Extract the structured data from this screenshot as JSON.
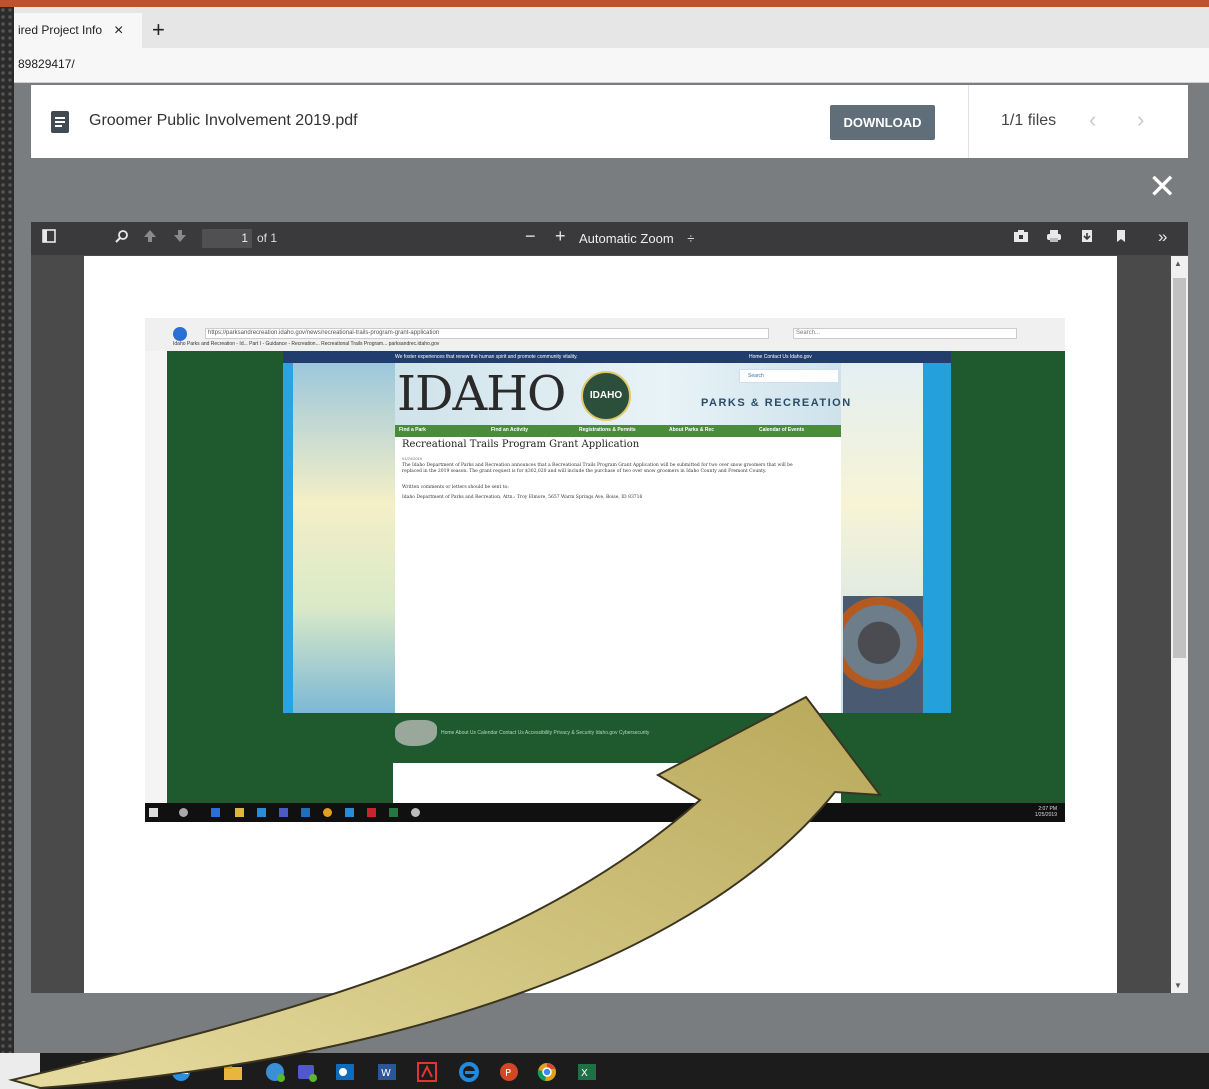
{
  "browser": {
    "tab_title": "ired Project Info",
    "tab_close": "×",
    "new_tab": "+",
    "address": "89829417/"
  },
  "file_bar": {
    "file_name": "Groomer Public Involvement 2019.pdf",
    "download_label": "DOWNLOAD",
    "files_count": "1/1 files",
    "prev": "‹",
    "next": "›"
  },
  "overlay_close": "✕",
  "pdf_toolbar": {
    "page_number": "1",
    "page_of": "of 1",
    "zoom_minus": "−",
    "zoom_plus": "+",
    "zoom_label": "Automatic Zoom",
    "zoom_caret": "÷",
    "more": "»"
  },
  "embedded_screenshot": {
    "url": "https://parksandrecreation.idaho.gov/news/recreational-trails-program-grant-application",
    "search_placeholder": "Search...",
    "tabs": "Idaho Parks and Recreation - Id...   Part I - Guidance - Recreation...   Recreational Trails Program...   parksandrec.idaho.gov",
    "site": {
      "tagline": "We foster experiences that renew the human spirit and promote community vitality.",
      "top_links": "Home   Contact Us   Idaho.gov",
      "logo": "IDAHO",
      "seal": "IDAHO",
      "search": "Search",
      "parks_recreation": "PARKS & RECREATION",
      "nav": [
        "Find a Park",
        "Find an Activity",
        "Registrations & Permits",
        "About Parks & Rec",
        "Calendar of Events"
      ],
      "heading": "Recreational Trails Program Grant Application",
      "date": "01/24/2019",
      "paragraph1": "The Idaho Department of Parks and Recreation announces that a Recreational Trails Program Grant Application will be submitted for two over snow groomers that will be replaced in the 2019 season. The grant request is for $302,020 and will include the purchase of two over snow groomers in Idaho County and Fremont County.",
      "paragraph2": "Written comments or letters should be sent to:",
      "paragraph3": "Idaho Department of Parks and Recreation, Attn.: Troy Elmore, 5657 Warm Springs Ave, Boise, ID 83716",
      "footer_links": "Home   About Us   Calendar   Contact Us   Accessibility   Privacy & Security   Idaho.gov   Cybersecurity"
    },
    "clock_time": "2:07 PM",
    "clock_date": "1/25/2019"
  },
  "colors": {
    "accent": "#c0522b",
    "download_button": "#5f6e78",
    "idaho_green": "#1e5a2e",
    "arrow_fill": "#cfc178"
  },
  "taskbar_icons": [
    "search-icon",
    "task-view-icon",
    "edge-icon",
    "folder-icon",
    "skype-icon",
    "teams-icon",
    "outlook-icon",
    "word-icon",
    "acrobat-icon",
    "edge-blue-icon",
    "powerpoint-icon",
    "chrome-icon",
    "excel-icon"
  ]
}
